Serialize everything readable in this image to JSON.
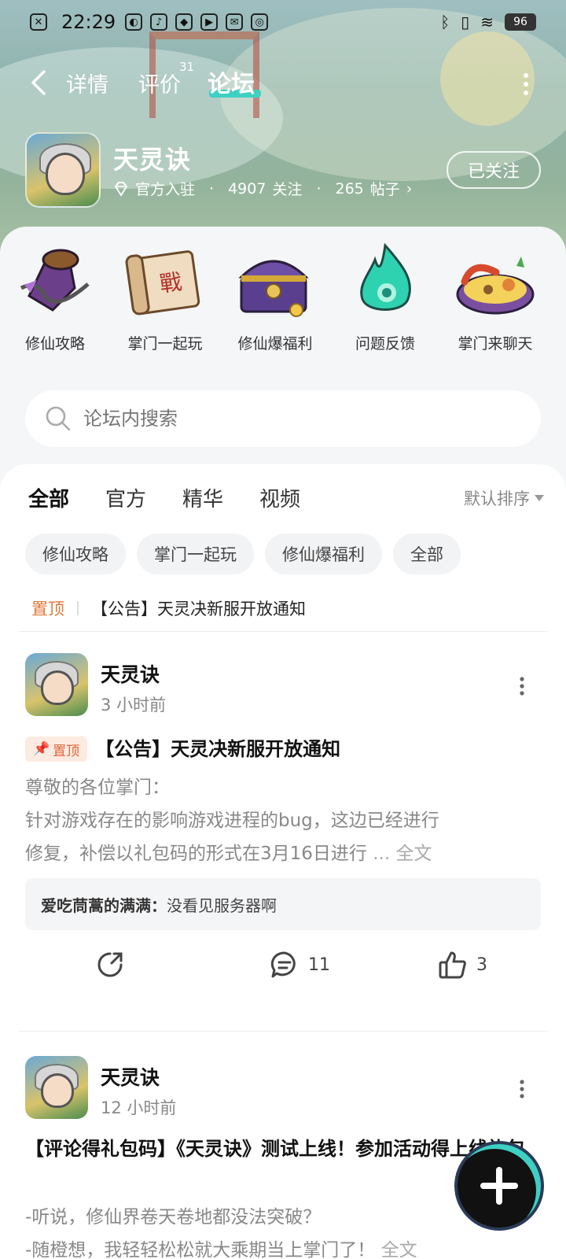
{
  "status_bar": {
    "time": "22:29",
    "battery": "96"
  },
  "nav": {
    "tabs": [
      {
        "label": "详情"
      },
      {
        "label": "评价",
        "count": "31"
      },
      {
        "label": "论坛"
      }
    ],
    "active": "论坛"
  },
  "game": {
    "name": "天灵诀",
    "badge": "官方入驻",
    "followers": "4907",
    "followers_label": "关注",
    "posts": "265",
    "posts_label": "帖子",
    "follow_button": "已关注"
  },
  "categories": [
    {
      "label": "修仙攻略",
      "icon": "scroll-chain-icon"
    },
    {
      "label": "掌门一起玩",
      "icon": "battle-scroll-icon"
    },
    {
      "label": "修仙爆福利",
      "icon": "treasure-chest-icon"
    },
    {
      "label": "问题反馈",
      "icon": "spirit-flame-icon"
    },
    {
      "label": "掌门来聊天",
      "icon": "feast-plate-icon"
    }
  ],
  "search": {
    "placeholder": "论坛内搜索"
  },
  "feed": {
    "tabs": [
      "全部",
      "官方",
      "精华",
      "视频"
    ],
    "active_tab": "全部",
    "sort": "默认排序",
    "chips": [
      "修仙攻略",
      "掌门一起玩",
      "修仙爆福利",
      "全部"
    ],
    "pinned": {
      "tag": "置顶",
      "title": "【公告】天灵决新服开放通知"
    }
  },
  "posts": [
    {
      "author": "天灵诀",
      "time": "3 小时前",
      "pin_badge": "置顶",
      "title": "【公告】天灵决新服开放通知",
      "body_lines": [
        "尊敬的各位掌门：",
        "针对游戏存在的影响游戏进程的bug，这边已经进行",
        "修复，补偿以礼包码的形式在3月16日进行"
      ],
      "ellipsis": "...",
      "full_text": "全文",
      "comment": {
        "user": "爱吃茼蒿的满满：",
        "text": "没看见服务器啊"
      },
      "comments_count": "11",
      "likes_count": "3"
    },
    {
      "author": "天灵诀",
      "time": "12 小时前",
      "title": "【评论得礼包码】《天灵诀》测试上线！参加活动得上线礼包",
      "body_lines": [
        "-听说，修仙界卷天卷地都没法突破？",
        "-随橙想，我轻轻松松就大乘期当上掌门了！"
      ],
      "full_text": "全文"
    }
  ],
  "colors": {
    "accent": "#3ed0c2",
    "pin": "#e07a3c"
  }
}
